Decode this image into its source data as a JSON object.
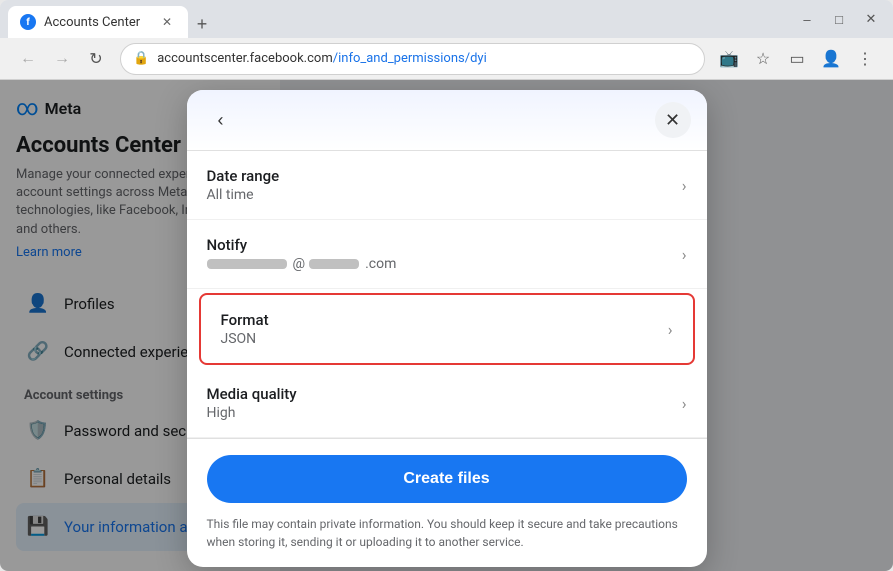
{
  "browser": {
    "tab_title": "Accounts Center",
    "tab_favicon": "f",
    "url": "accountscenter.facebook.com/info_and_permissions/dyi",
    "url_display_prefix": "accountscenter.facebook.com",
    "url_display_suffix": "/info_and_permissions/dyi"
  },
  "sidebar": {
    "meta_logo_text": "Meta",
    "page_title": "Accounts Center",
    "description": "Manage your connected experiences and account settings across Meta technologies, like Facebook, Instagram and others.",
    "learn_more": "Learn more",
    "nav_items": [
      {
        "id": "profiles",
        "label": "Profiles",
        "icon": "👤"
      },
      {
        "id": "connected",
        "label": "Connected experiences",
        "icon": "🔗"
      }
    ],
    "account_settings_title": "Account settings",
    "account_settings_items": [
      {
        "id": "password",
        "label": "Password and security",
        "icon": "🛡️"
      },
      {
        "id": "personal",
        "label": "Personal details",
        "icon": "📋"
      },
      {
        "id": "your_info",
        "label": "Your information and",
        "icon": "💾",
        "active": true
      }
    ]
  },
  "modal": {
    "back_label": "‹",
    "close_label": "✕",
    "settings": [
      {
        "id": "date_range",
        "label": "Date range",
        "value": "All time",
        "highlighted": false
      },
      {
        "id": "notify",
        "label": "Notify",
        "value": "@",
        "value_suffix": ".com",
        "type": "email",
        "highlighted": false
      },
      {
        "id": "format",
        "label": "Format",
        "value": "JSON",
        "highlighted": true
      },
      {
        "id": "media_quality",
        "label": "Media quality",
        "value": "High",
        "highlighted": false
      }
    ],
    "create_files_label": "Create files",
    "privacy_notice": "This file may contain private information. You should keep it secure and take precautions when storing it, sending it or uploading it to another service."
  },
  "colors": {
    "accent_blue": "#1877f2",
    "highlight_red": "#e53935",
    "text_primary": "#1c1e21",
    "text_secondary": "#65676b"
  }
}
